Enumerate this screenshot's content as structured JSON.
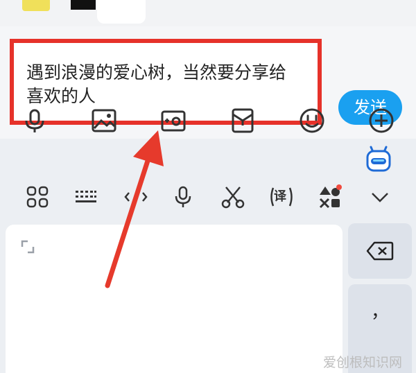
{
  "composer": {
    "message_text": "遇到浪漫的爱心树，当然要分享给喜欢的人",
    "send_label": "发送"
  },
  "action_icons": [
    "microphone-icon",
    "image-icon",
    "camera-icon",
    "red-packet-icon",
    "emoji-icon",
    "plus-icon"
  ],
  "keyboard": {
    "toolbar_icons": [
      "grid-menu-icon",
      "keyboard-icon",
      "cursor-move-icon",
      "voice-icon",
      "clipboard-cut-icon",
      "translate-icon",
      "shapes-icon",
      "collapse-chevron-icon"
    ],
    "translate_glyph": "译",
    "comma_key": "，"
  },
  "watermark": "爱创根知识网",
  "colors": {
    "highlight_border": "#e6322a",
    "send_button": "#1aa0f0",
    "arrow": "#e63a2c"
  }
}
